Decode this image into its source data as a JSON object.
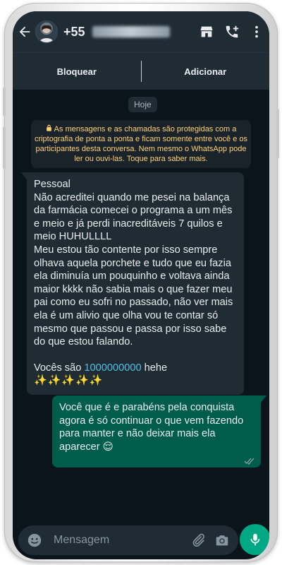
{
  "header": {
    "contact_number": "+55",
    "icons": [
      "back-arrow-icon",
      "avatar",
      "storefront-icon",
      "add-call-icon",
      "more-vert-icon"
    ]
  },
  "actions": {
    "block_label": "Bloquear",
    "add_label": "Adicionar"
  },
  "chat": {
    "date_chip": "Hoje",
    "encryption_notice": "As mensagens e as chamadas são protegidas com a criptografia de ponta a ponta e ficam somente entre você e os participantes desta conversa. Nem mesmo o WhatsApp pode ler ou ouvi-las. Toque para saber mais.",
    "incoming": {
      "p1": "Pessoal",
      "p2": "Não acreditei quando me pesei na balança da farmácia comecei o programa a um mês e meio e já perdi inacreditáveis 7 quilos e meio HUHULLLL",
      "p3": "Meu estou tão contente por isso sempre olhava aquela porchete e tudo que eu fazia ela diminuía um pouquinho e voltava ainda maior kkkk não sabia mais o que fazer meu pai como eu sofri no passado, não ver mais ela é um alivio que olha vou te contar só mesmo que passou e passa por isso sabe do que estou falando.",
      "p4_prefix": "Vocês são ",
      "p4_link": "1000000000",
      "p4_suffix": " hehe",
      "sparkles": "✨✨✨✨✨"
    },
    "outgoing": {
      "text": "Você que é e parabéns pela conquista agora é só continuar o que vem fazendo para manter e não deixar mais ela aparecer",
      "emoji": "😌",
      "status": "read"
    }
  },
  "composer": {
    "placeholder": "Mensagem"
  },
  "colors": {
    "header_bg": "#1f2c34",
    "chat_bg": "#0b141a",
    "incoming_bubble": "#1f2c34",
    "outgoing_bubble": "#005c4b",
    "encryption_text": "#ffd279",
    "link": "#53bdeb",
    "accent": "#00a884"
  }
}
